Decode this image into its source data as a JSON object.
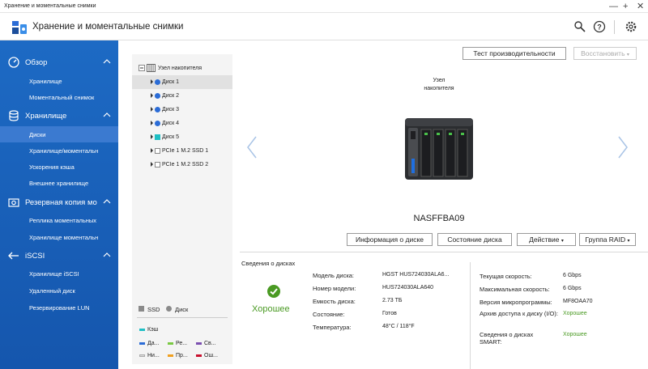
{
  "window": {
    "title": "Хранение и моментальные снимки",
    "minimize": "—",
    "maximize": "+",
    "close": "✕"
  },
  "header": {
    "title": "Хранение и моментальные снимки"
  },
  "sidebar": {
    "sections": [
      {
        "label": "Обзор",
        "items": [
          "Хранилище",
          "Моментальный снимок"
        ]
      },
      {
        "label": "Хранилище",
        "items": [
          "Диски",
          "Хранилище/моментальн",
          "Ускорения кэша",
          "Внешнее хранилище"
        ]
      },
      {
        "label": "Резервная копия мо",
        "items": [
          "Реплика моментальных",
          "Хранилище моментальн"
        ]
      },
      {
        "label": "iSCSI",
        "items": [
          "Хранилище iSCSI",
          "Удаленный диск",
          "Резервирование LUN"
        ]
      }
    ]
  },
  "tree": {
    "root": "Узел накопителя",
    "items": [
      "Диск 1",
      "Диск 2",
      "Диск 3",
      "Диск 4",
      "Диск 5",
      "PCIe 1 M.2 SSD 1",
      "PCIe 1 M.2 SSD 2"
    ]
  },
  "legend": {
    "ssd": "SSD",
    "disk": "Диск",
    "cache": "Кэш",
    "row1": [
      "Да...",
      "Ре...",
      "Св..."
    ],
    "row2": [
      "Ни...",
      "Пр...",
      "Ош..."
    ]
  },
  "toolbar": {
    "perf_test": "Тест производительности",
    "restore": "Восстановить"
  },
  "device": {
    "label_line1": "Узел",
    "label_line2": "накопителя",
    "name": "NASFFBA09"
  },
  "actions": {
    "disk_info": "Информация о диске",
    "disk_status": "Состояние диска",
    "action": "Действие",
    "raid_group": "Группа RAID"
  },
  "disk_info": {
    "section_title": "Сведения о дисках",
    "status": "Хорошее",
    "left_labels": [
      "Модель диска:",
      "Номер модели:",
      "Емкость диска:",
      "Состояние:",
      "Температура:"
    ],
    "left_values": [
      "HGST HUS724030ALA6...",
      "HUS724030ALA640",
      "2.73 ТБ",
      "Готов",
      "48°C / 118°F"
    ],
    "right_labels": [
      "Текущая скорость:",
      "Максимальная скорость:",
      "Версия микропрограммы:",
      "Архив доступа к диску (I/O):",
      "Сведения о дисках SMART:"
    ],
    "right_values": [
      "6 Gbps",
      "6 Gbps",
      "MF8OAA70",
      "Хорошее",
      "Хорошее"
    ]
  },
  "colors": {
    "sidebar": "#1a5fb4",
    "good": "#4a9a23",
    "disk_blue": "#2b6cd6",
    "cache_cyan": "#1fbfc4"
  }
}
